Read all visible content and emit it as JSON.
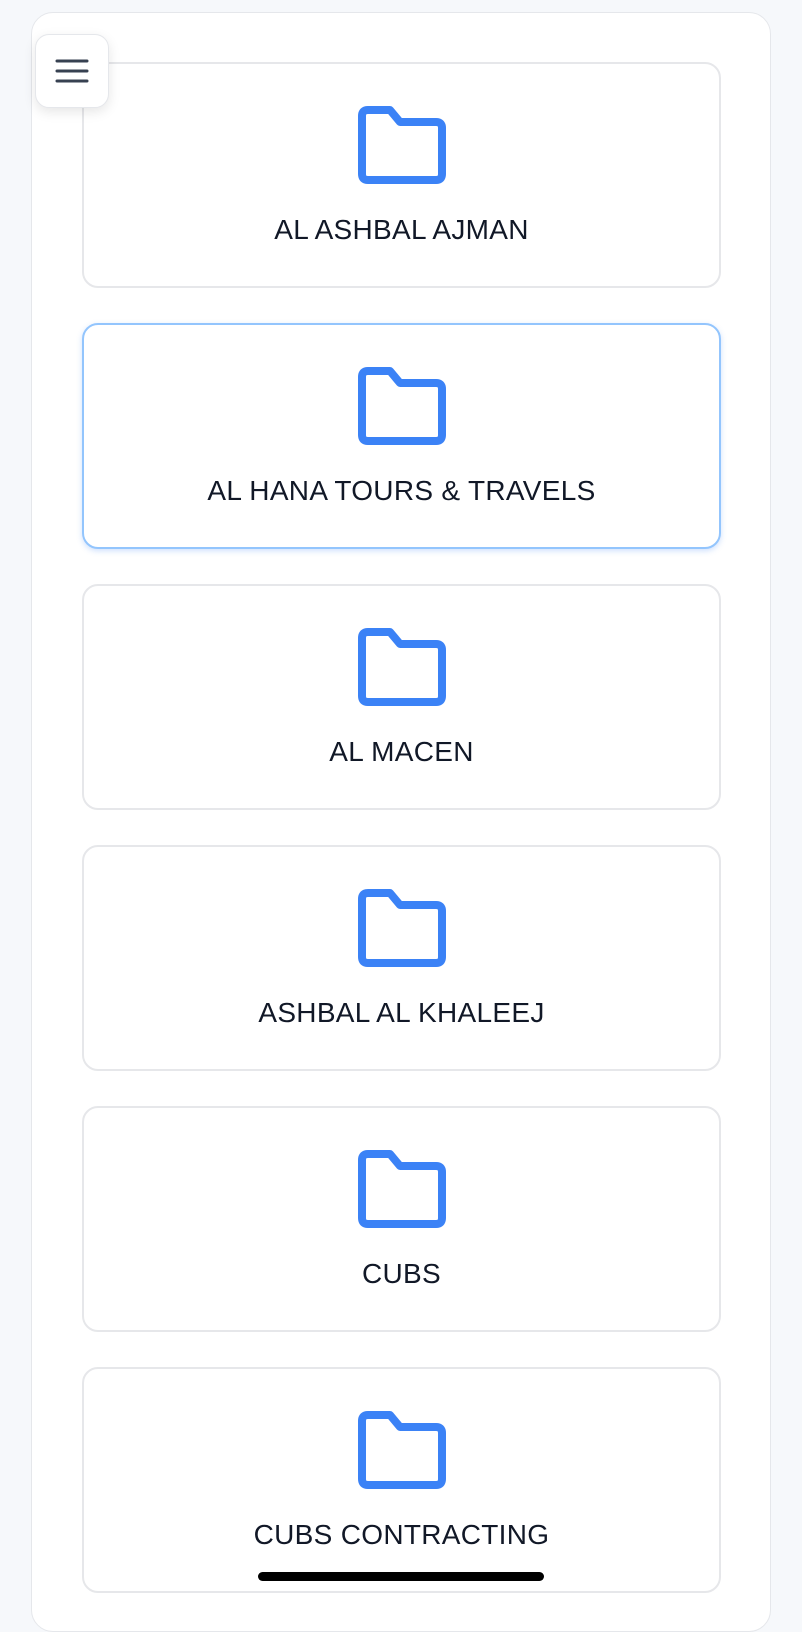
{
  "menu": {
    "icon": "hamburger-menu-icon"
  },
  "colors": {
    "accent": "#3b82f6",
    "text": "#111827",
    "card_border": "#e6e7ea",
    "selected_border": "#93c5fd"
  },
  "folders": [
    {
      "label": "AL ASHBAL AJMAN",
      "icon": "folder-icon"
    },
    {
      "label": "AL HANA TOURS & TRAVELS",
      "icon": "folder-icon"
    },
    {
      "label": "AL MACEN",
      "icon": "folder-icon"
    },
    {
      "label": "ASHBAL AL KHALEEJ",
      "icon": "folder-icon"
    },
    {
      "label": "CUBS",
      "icon": "folder-icon"
    },
    {
      "label": "CUBS CONTRACTING",
      "icon": "folder-icon"
    }
  ]
}
